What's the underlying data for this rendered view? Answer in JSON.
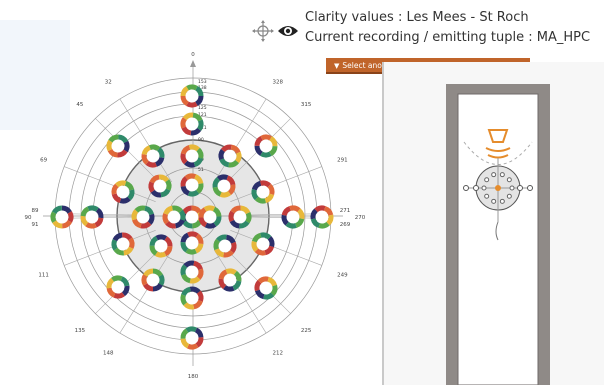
{
  "header": {
    "line1": "Clarity values : Les Mees - St Roch",
    "line2": "Current recording / emitting tuple : MA_HPC",
    "select_label": "Select anoth",
    "icons": [
      "move-icon",
      "eye-icon",
      "caret-down-icon"
    ]
  },
  "polar_plot": {
    "angle_labels": [
      {
        "text": "0",
        "deg": 0
      },
      {
        "text": "32",
        "deg": 32
      },
      {
        "text": "45",
        "deg": 45
      },
      {
        "text": "69",
        "deg": 69
      },
      {
        "text": "89",
        "deg": 89
      },
      {
        "text": "90",
        "deg": 90
      },
      {
        "text": "91",
        "deg": 91
      },
      {
        "text": "111",
        "deg": 111
      },
      {
        "text": "135",
        "deg": 135
      },
      {
        "text": "148",
        "deg": 148
      },
      {
        "text": "180",
        "deg": 180
      },
      {
        "text": "212",
        "deg": 212
      },
      {
        "text": "225",
        "deg": 225
      },
      {
        "text": "249",
        "deg": 249
      },
      {
        "text": "269",
        "deg": 269
      },
      {
        "text": "270",
        "deg": 270
      },
      {
        "text": "271",
        "deg": 271
      },
      {
        "text": "291",
        "deg": 291
      },
      {
        "text": "315",
        "deg": 315
      },
      {
        "text": "328",
        "deg": 328
      }
    ],
    "inner_labels": [
      "153",
      "138",
      "125",
      "121",
      "111",
      "90",
      "59",
      "51"
    ],
    "ring_colors": [
      "#2b2f6b",
      "#c23b3b",
      "#e0683a",
      "#e8b83a",
      "#59a84b",
      "#2f8a6a"
    ]
  }
}
